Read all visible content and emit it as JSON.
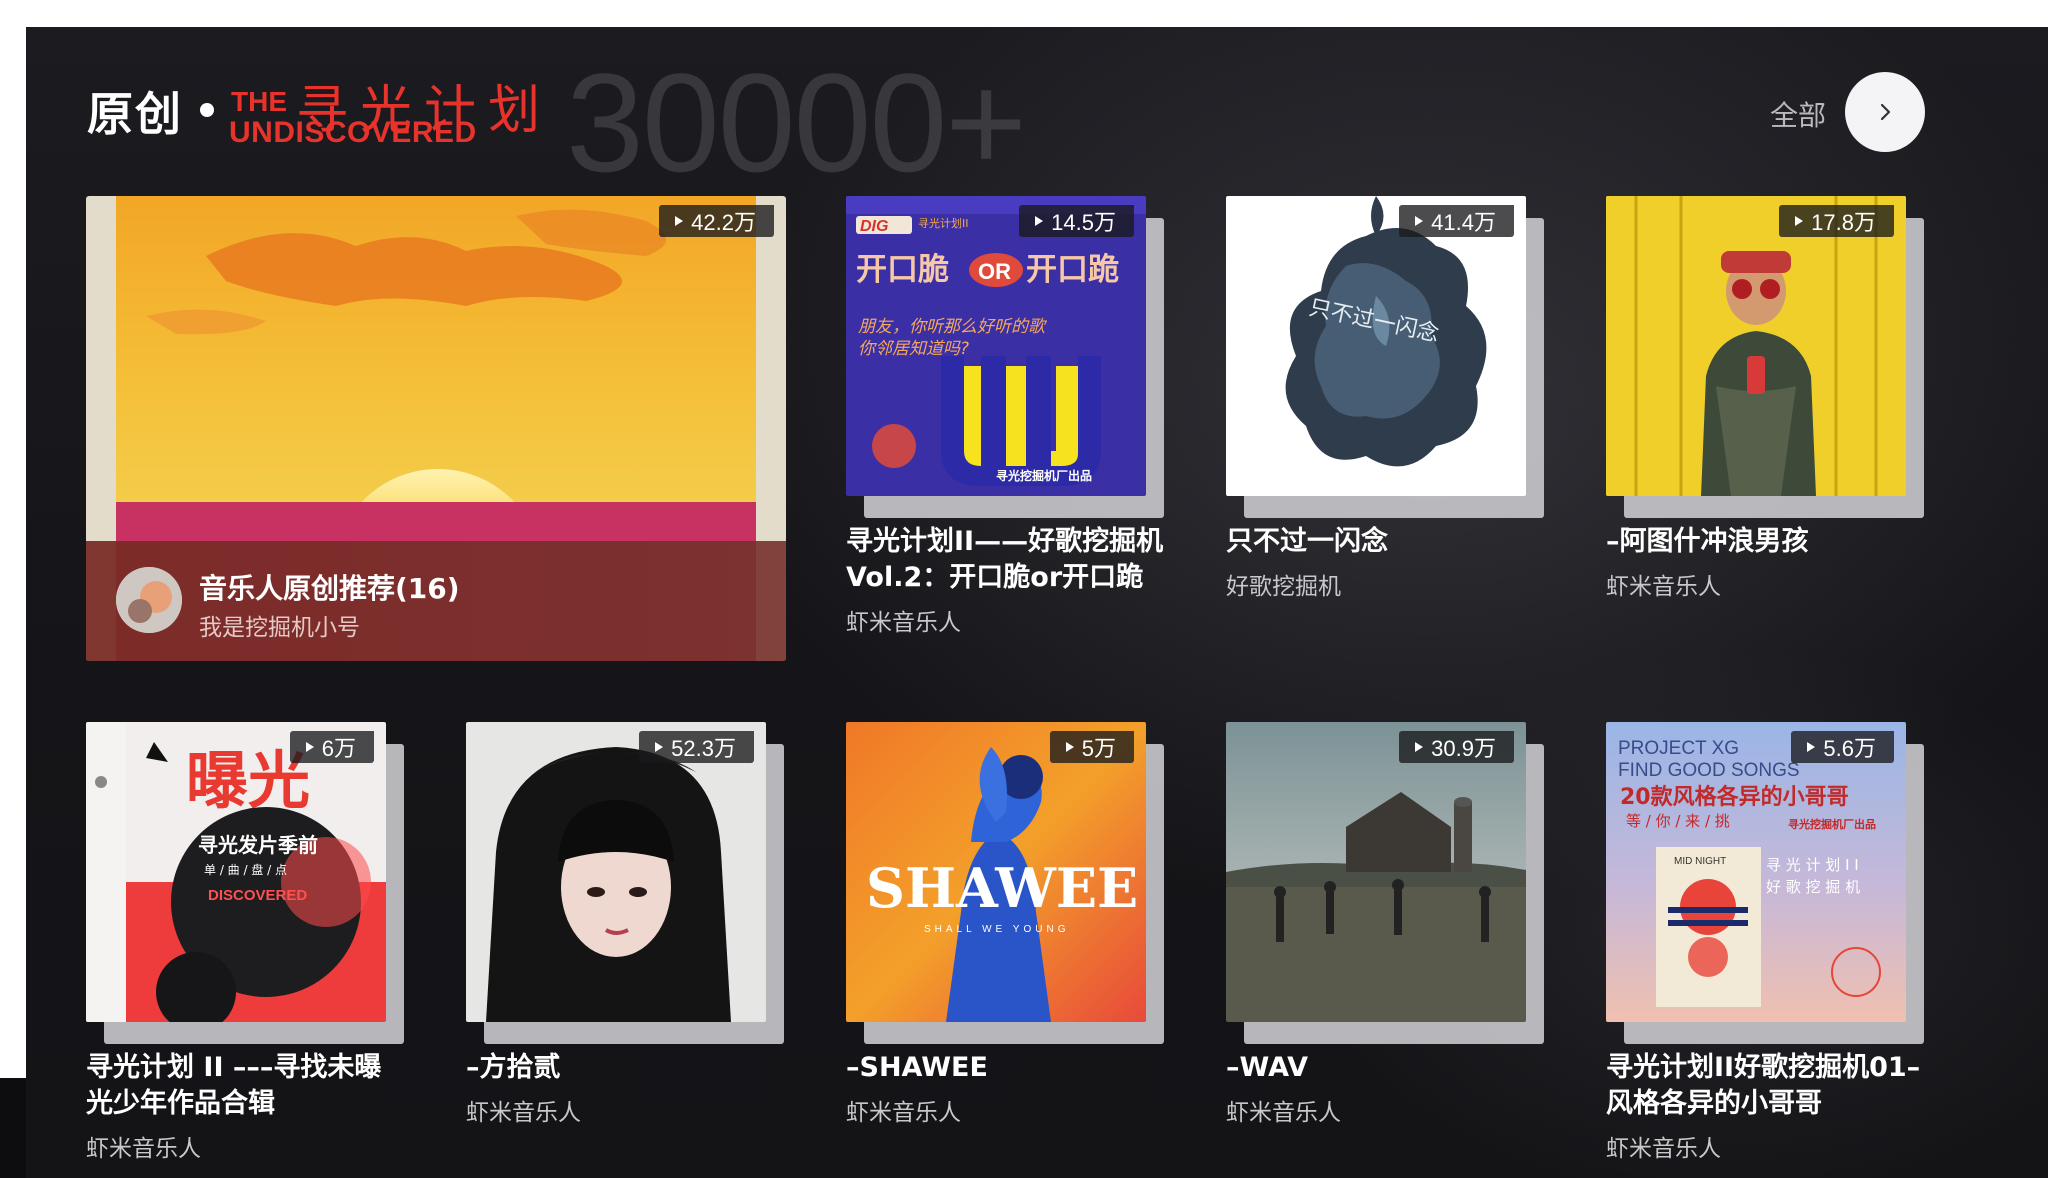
{
  "header": {
    "title": "原创",
    "logo_en_top": "THE",
    "logo_en_bottom": "UNDISCOVERED",
    "logo_cn": "寻光计划",
    "count": "30000+",
    "all_label": "全部"
  },
  "featured": {
    "play_count": "42.2万",
    "title": "音乐人原创推荐(16)",
    "subtitle": "我是挖掘机小号"
  },
  "cards": [
    {
      "play_count": "14.5万",
      "title": "寻光计划II——好歌挖掘机Vol.2：开口脆or开口跪",
      "subtitle": "虾米音乐人",
      "cover_text": {
        "dig": "DIG",
        "badge": "寻光计划II",
        "headline_a": "开口脆",
        "or": "OR",
        "headline_b": "开口跪",
        "line1": "朋友，你听那么好听的歌",
        "line2": "你邻居知道吗?",
        "footer": "寻光挖掘机厂出品"
      }
    },
    {
      "play_count": "41.4万",
      "title": "只不过一闪念",
      "subtitle": "好歌挖掘机",
      "cover_text": {
        "vertical": "只不过一闪念"
      }
    },
    {
      "play_count": "17.8万",
      "title": "–阿图什冲浪男孩",
      "subtitle": "虾米音乐人"
    },
    {
      "play_count": "6万",
      "title": "寻光计划 II –––寻找未曝光少年作品合辑",
      "subtitle": "虾米音乐人",
      "cover_text": {
        "big": "曝光",
        "line1": "寻光发片季前",
        "line2": "单 / 曲 / 盘 / 点",
        "line3": "DISCOVERED"
      }
    },
    {
      "play_count": "52.3万",
      "title": "–方拾贰",
      "subtitle": "虾米音乐人"
    },
    {
      "play_count": "5万",
      "title": "–SHAWEE",
      "subtitle": "虾米音乐人",
      "cover_text": {
        "big": "SHAWEE",
        "small": "SHALL WE YOUNG"
      }
    },
    {
      "play_count": "30.9万",
      "title": "–WAV",
      "subtitle": "虾米音乐人"
    },
    {
      "play_count": "5.6万",
      "title": "寻光计划II好歌挖掘机01–风格各异的小哥哥",
      "subtitle": "虾米音乐人",
      "cover_text": {
        "l1": "PROJECT XG",
        "l2": "FIND GOOD SONGS",
        "l3": "20款风格各异的小哥哥",
        "l4": "等 / 你 / 来 / 挑",
        "l5": "寻光挖掘机厂出品",
        "l6": "MID NIGHT",
        "l7": "寻 光 计 划 I I",
        "l8": "好 歌 挖 掘 机"
      }
    }
  ],
  "colors": {
    "accent_red": "#e8332c",
    "background": "#161619"
  }
}
